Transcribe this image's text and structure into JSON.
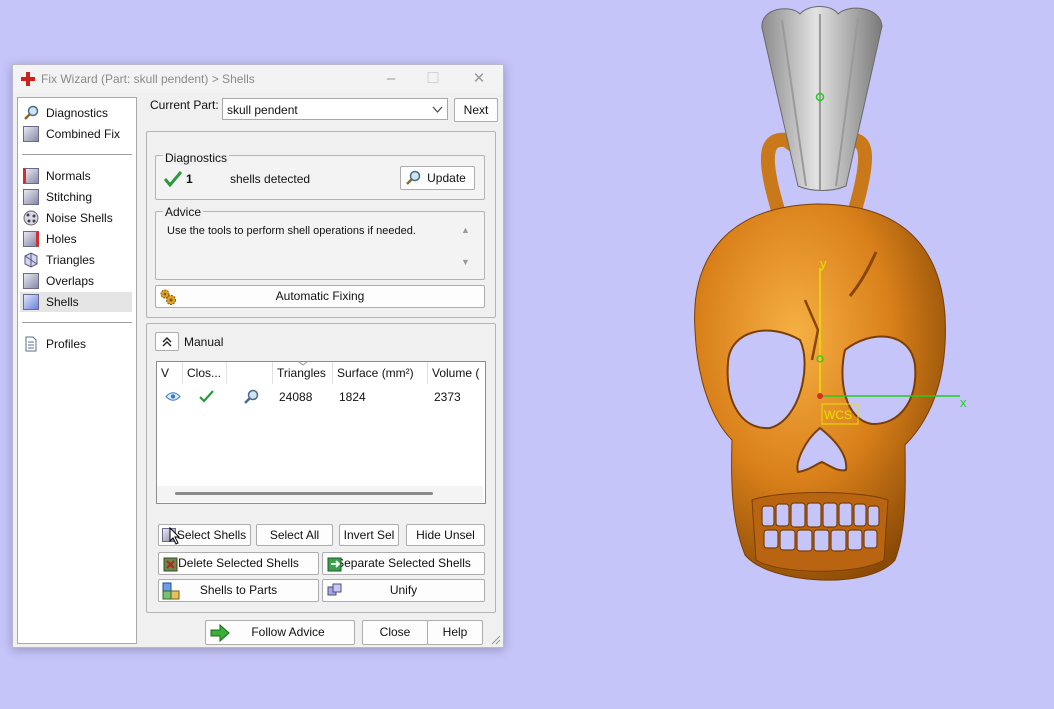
{
  "window": {
    "title": "Fix Wizard (Part: skull pendent) > Shells",
    "controls": [
      "–",
      "☐",
      "✕"
    ]
  },
  "nav": {
    "items": [
      {
        "label": "Diagnostics",
        "icon": "magnifier-icon"
      },
      {
        "label": "Combined Fix",
        "icon": "combined-fix-icon"
      },
      {
        "label": "Normals",
        "icon": "normals-icon"
      },
      {
        "label": "Stitching",
        "icon": "stitching-icon"
      },
      {
        "label": "Noise Shells",
        "icon": "noise-shells-icon"
      },
      {
        "label": "Holes",
        "icon": "holes-icon"
      },
      {
        "label": "Triangles",
        "icon": "triangles-icon"
      },
      {
        "label": "Overlaps",
        "icon": "overlaps-icon"
      },
      {
        "label": "Shells",
        "icon": "shells-icon",
        "selected": true
      },
      {
        "label": "Profiles",
        "icon": "profiles-icon"
      }
    ]
  },
  "part": {
    "label": "Current Part:",
    "value": "skull pendent",
    "next_label": "Next"
  },
  "diagnostics": {
    "label": "Diagnostics",
    "count": "1",
    "text": "shells detected",
    "update_label": "Update"
  },
  "advice": {
    "label": "Advice",
    "text": "Use the tools to perform shell operations if needed."
  },
  "automatic_fixing_label": "Automatic Fixing",
  "manual": {
    "label": "Manual",
    "columns": [
      "V",
      "Clos...",
      "",
      "Triangles",
      "Surface (mm²)",
      "Volume ("
    ],
    "rows": [
      {
        "triangles": "24088",
        "surface": "1824",
        "volume": "2373"
      }
    ]
  },
  "buttons": {
    "select_shells": "Select Shells",
    "select_all": "Select All",
    "invert_sel": "Invert Sel",
    "hide_unsel": "Hide Unsel",
    "delete_selected": "Delete Selected Shells",
    "separate_selected": "Separate Selected Shells",
    "shells_to_parts": "Shells to Parts",
    "unify": "Unify"
  },
  "footer": {
    "follow_advice": "Follow Advice",
    "close": "Close",
    "help": "Help"
  },
  "viewport": {
    "axis_y": "y",
    "axis_x": "x",
    "wcs_label": "WCS",
    "colors": {
      "background": "#c6c5fa",
      "model": "#e08a1e",
      "bail": "#b9b9b9",
      "axis_y": "#e8e000",
      "axis_x": "#22cc22"
    }
  }
}
